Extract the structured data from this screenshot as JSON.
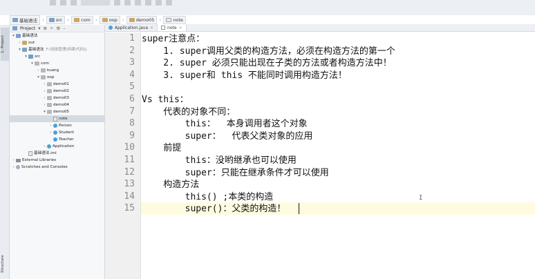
{
  "breadcrumb": [
    "基础语法",
    "src",
    "com",
    "oop",
    "demo05",
    "note"
  ],
  "project_panel": {
    "title": "Project",
    "tree": [
      {
        "label": "基础语法",
        "depth": 0,
        "arrow": "▾",
        "icon": "folder-blue",
        "hint": ""
      },
      {
        "label": "out",
        "depth": 1,
        "arrow": "›",
        "icon": "folder",
        "hint": ""
      },
      {
        "label": "基础语法",
        "depth": 1,
        "arrow": "▾",
        "icon": "folder-blue",
        "hint": "F:\\班级管理\\网课\\代码\\J"
      },
      {
        "label": "src",
        "depth": 2,
        "arrow": "▾",
        "icon": "folder-src",
        "hint": ""
      },
      {
        "label": "com",
        "depth": 3,
        "arrow": "▾",
        "icon": "pkg",
        "hint": ""
      },
      {
        "label": "kuang",
        "depth": 4,
        "arrow": "›",
        "icon": "pkg",
        "hint": ""
      },
      {
        "label": "oop",
        "depth": 4,
        "arrow": "▾",
        "icon": "pkg",
        "hint": ""
      },
      {
        "label": "demo01",
        "depth": 5,
        "arrow": "›",
        "icon": "pkg",
        "hint": ""
      },
      {
        "label": "demo02",
        "depth": 5,
        "arrow": "›",
        "icon": "pkg",
        "hint": ""
      },
      {
        "label": "demo03",
        "depth": 5,
        "arrow": "›",
        "icon": "pkg",
        "hint": ""
      },
      {
        "label": "demo04",
        "depth": 5,
        "arrow": "›",
        "icon": "pkg",
        "hint": ""
      },
      {
        "label": "demo05",
        "depth": 5,
        "arrow": "▾",
        "icon": "pkg",
        "hint": ""
      },
      {
        "label": "note",
        "depth": 6,
        "arrow": "",
        "icon": "file",
        "hint": "",
        "selected": true
      },
      {
        "label": "Person",
        "depth": 6,
        "arrow": "›",
        "icon": "class",
        "hint": ""
      },
      {
        "label": "Student",
        "depth": 6,
        "arrow": "›",
        "icon": "class",
        "hint": ""
      },
      {
        "label": "Teacher",
        "depth": 6,
        "arrow": "",
        "icon": "class",
        "hint": ""
      },
      {
        "label": "Application",
        "depth": 5,
        "arrow": "›",
        "icon": "class",
        "hint": ""
      },
      {
        "label": "基础语法.iml",
        "depth": 2,
        "arrow": "",
        "icon": "file",
        "hint": ""
      },
      {
        "label": "External Libraries",
        "depth": 0,
        "arrow": "›",
        "icon": "libs",
        "hint": ""
      },
      {
        "label": "Scratches and Consoles",
        "depth": 0,
        "arrow": "›",
        "icon": "scratch",
        "hint": ""
      }
    ]
  },
  "side_tabs": {
    "project": "1: Project",
    "structure": "Structure"
  },
  "editor_tabs": [
    {
      "label": "Application.java",
      "type": "java",
      "active": false
    },
    {
      "label": "note",
      "type": "txt",
      "active": true
    }
  ],
  "code_lines": [
    "super注意点：",
    "    1. super调用父类的构造方法，必须在构造方法的第一个",
    "    2. super 必须只能出现在子类的方法或者构造方法中！",
    "    3. super和 this 不能同时调用构造方法！",
    "",
    "Vs this：",
    "    代表的对象不同：",
    "        this：  本身调用者这个对象",
    "        super：  代表父类对象的应用",
    "    前提",
    "        this：没哟继承也可以使用",
    "        super：只能在继承条件才可以使用",
    "    构造方法",
    "        this() ;本类的构造",
    "        super()：父类的构造！"
  ],
  "cursor_line": 15
}
